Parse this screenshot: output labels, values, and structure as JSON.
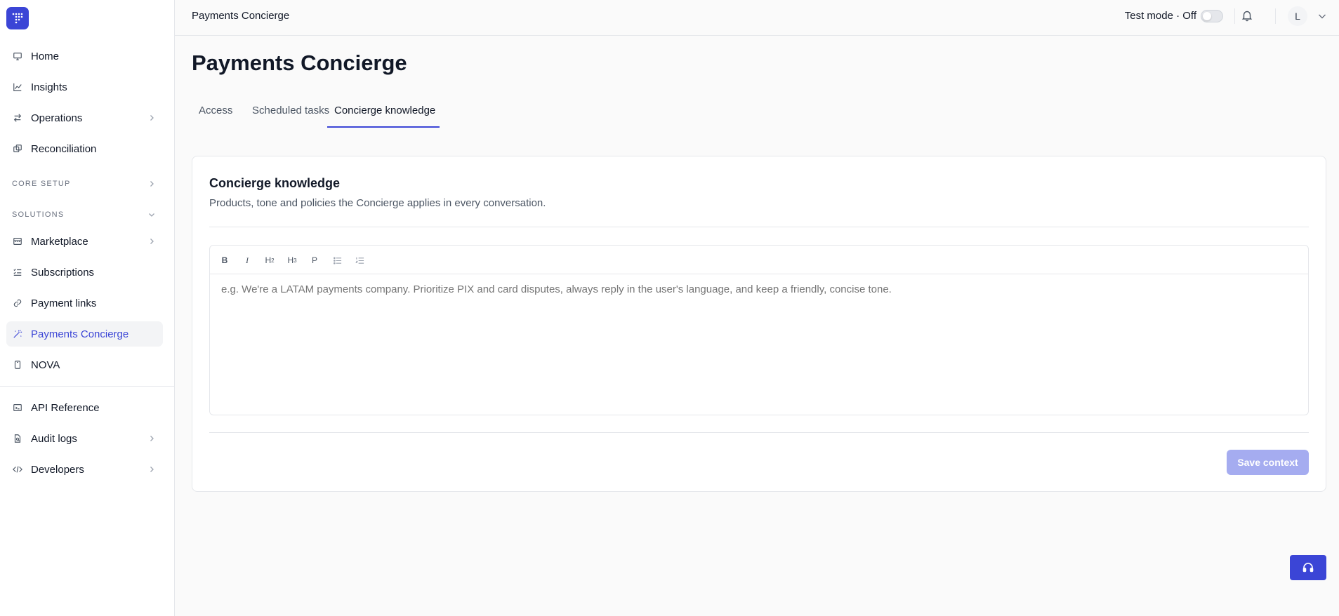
{
  "sidebar": {
    "items_top": [
      {
        "label": "Home",
        "icon": "monitor-icon"
      },
      {
        "label": "Insights",
        "icon": "chart-line-icon"
      },
      {
        "label": "Operations",
        "icon": "arrows-swap-icon"
      },
      {
        "label": "Reconciliation",
        "icon": "reconcile-icon"
      }
    ],
    "section_core": "CORE SETUP",
    "section_solutions": "SOLUTIONS",
    "items_solutions": [
      {
        "label": "Marketplace",
        "icon": "store-icon"
      },
      {
        "label": "Subscriptions",
        "icon": "list-check-icon"
      },
      {
        "label": "Payment links",
        "icon": "link-icon"
      },
      {
        "label": "Payments Concierge",
        "icon": "wand-icon"
      },
      {
        "label": "NOVA",
        "icon": "device-icon"
      }
    ],
    "items_bottom": [
      {
        "label": "API Reference",
        "icon": "terminal-icon"
      },
      {
        "label": "Audit logs",
        "icon": "file-search-icon"
      },
      {
        "label": "Developers",
        "icon": "code-icon"
      }
    ]
  },
  "topbar": {
    "breadcrumb": "Payments Concierge",
    "test_mode": "Test mode · Off",
    "avatar_initial": "L"
  },
  "main": {
    "title": "Payments Concierge",
    "tabs": [
      {
        "label": "Access"
      },
      {
        "label": "Scheduled tasks"
      },
      {
        "label": "Concierge knowledge"
      }
    ]
  },
  "card": {
    "title": "Concierge knowledge",
    "subtitle": "Products, tone and policies the Concierge applies in every conversation.",
    "toolbar": {
      "bold": "B",
      "italic": "I",
      "h2": "H",
      "h2_sub": "2",
      "h3": "H",
      "h3_sub": "3",
      "paragraph": "P"
    },
    "editor_placeholder": "e.g. We're a LATAM payments company. Prioritize PIX and card disputes, always reply in the user's language, and keep a friendly, concise tone.",
    "save_label": "Save context"
  },
  "colors": {
    "accent": "#3b45d6",
    "accent_disabled": "#a5acf0"
  }
}
